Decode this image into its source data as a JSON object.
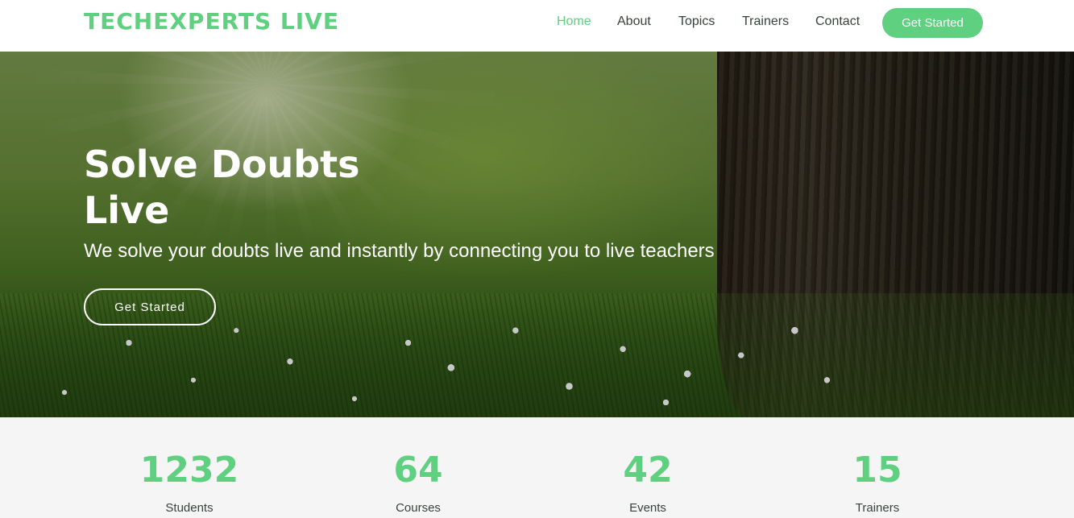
{
  "header": {
    "logo": "TECHEXPERTS LIVE",
    "nav": [
      {
        "label": "Home",
        "active": true
      },
      {
        "label": "About",
        "active": false
      },
      {
        "label": "Topics",
        "active": false
      },
      {
        "label": "Trainers",
        "active": false
      },
      {
        "label": "Contact",
        "active": false
      }
    ],
    "cta_label": "Get Started"
  },
  "hero": {
    "title_line1": "Solve Doubts",
    "title_line2": "Live",
    "subtitle": "We solve your doubts live and instantly by connecting you to live teachers",
    "cta_label": "Get Started",
    "background": "forest-grass-tree-photo"
  },
  "counts": [
    {
      "number": "1232",
      "label": "Students"
    },
    {
      "number": "64",
      "label": "Courses"
    },
    {
      "number": "42",
      "label": "Events"
    },
    {
      "number": "15",
      "label": "Trainers"
    }
  ],
  "colors": {
    "accent": "#5fcf80",
    "text_dark": "#37423b",
    "counts_bg": "#f5f5f5"
  }
}
